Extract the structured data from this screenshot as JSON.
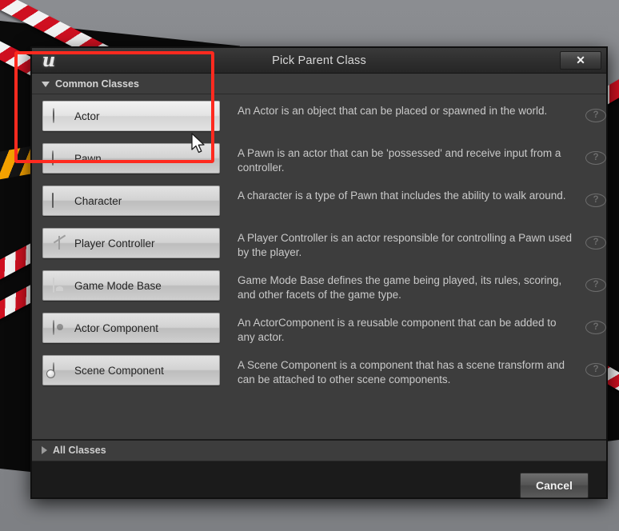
{
  "window": {
    "title": "Pick Parent Class",
    "logo_glyph": "u",
    "close_label": "✕"
  },
  "sections": {
    "common_classes_label": "Common Classes",
    "all_classes_label": "All Classes"
  },
  "classes": [
    {
      "label": "Actor",
      "icon": "sphere-icon",
      "description": "An Actor is an object that can be placed or spawned in the world.",
      "help": "?",
      "highlighted": true
    },
    {
      "label": "Pawn",
      "icon": "pawn-icon",
      "description": "A Pawn is an actor that can be 'possessed' and receive input from a controller.",
      "help": "?",
      "highlighted": false
    },
    {
      "label": "Character",
      "icon": "capsule-icon",
      "description": "A character is a type of Pawn that includes the ability to walk around.",
      "help": "?",
      "highlighted": false
    },
    {
      "label": "Player Controller",
      "icon": "player-controller-icon",
      "description": "A Player Controller is an actor responsible for controlling a Pawn used by the player.",
      "help": "?",
      "highlighted": false
    },
    {
      "label": "Game Mode Base",
      "icon": "game-mode-icon",
      "description": "Game Mode Base defines the game being played, its rules, scoring, and other facets of the game type.",
      "help": "?",
      "highlighted": false
    },
    {
      "label": "Actor Component",
      "icon": "actor-component-icon",
      "description": "An ActorComponent is a reusable component that can be added to any actor.",
      "help": "?",
      "highlighted": false
    },
    {
      "label": "Scene Component",
      "icon": "scene-component-icon",
      "description": "A Scene Component is a component that has a scene transform and can be attached to other scene components.",
      "help": "?",
      "highlighted": false
    }
  ],
  "footer": {
    "cancel_label": "Cancel"
  },
  "annotation": {
    "color": "#ff2a1f"
  },
  "theme": {
    "dialog_bg": "#3d3d3d",
    "titlebar_bg": "#2e2e2e",
    "footer_bg": "#1b1b1b",
    "text": "#c9c9c9",
    "button_face": "#d2d2d2"
  }
}
